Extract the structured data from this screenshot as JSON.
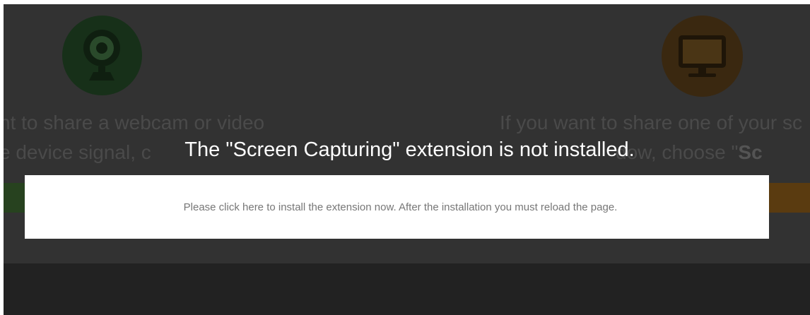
{
  "background": {
    "left": {
      "icon": "webcam-icon",
      "line1": "nt to share a webcam or video",
      "line2": "e device signal, c"
    },
    "right": {
      "icon": "monitor-icon",
      "line1": "If you want to share one of your sc",
      "line2_prefix": "dow, choose \"",
      "line2_bold": "Sc"
    }
  },
  "modal": {
    "title": "The \"Screen Capturing\" extension is not installed.",
    "message": "Please click here to install the extension now. After the installation you must reload the page."
  },
  "colors": {
    "overlay": "#323232",
    "webcam_accent": "#173019",
    "monitor_accent": "#3a2810",
    "modal_bg": "#ffffff"
  }
}
